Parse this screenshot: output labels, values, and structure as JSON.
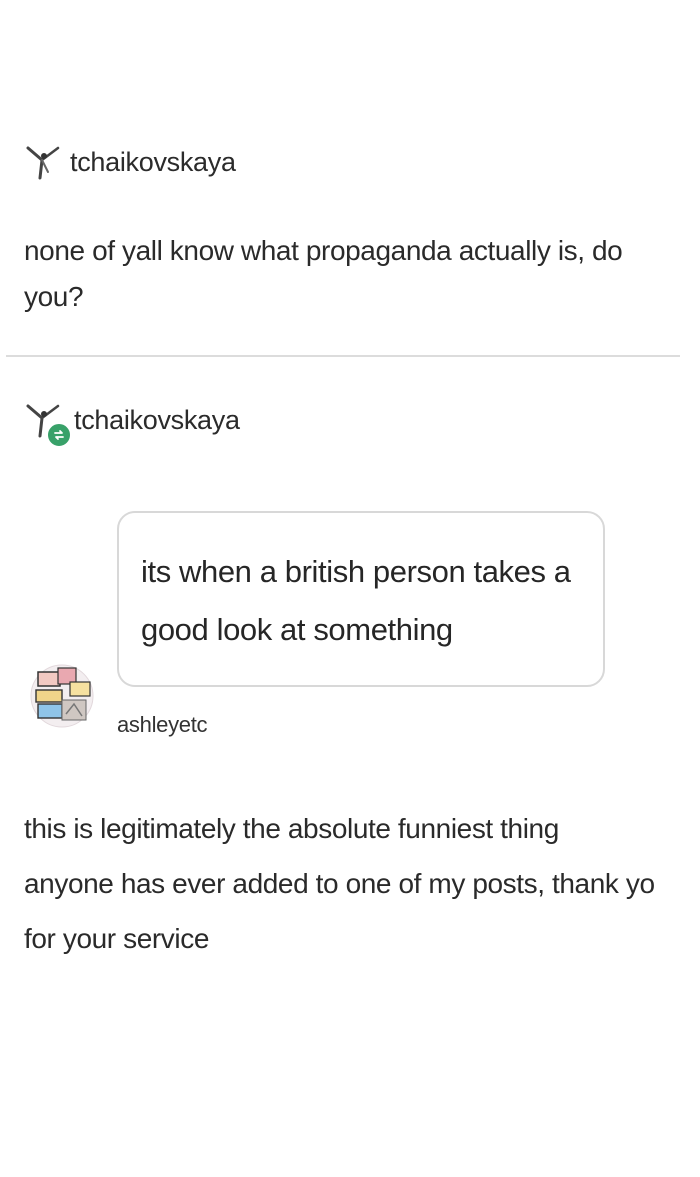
{
  "original_post": {
    "username": "tchaikovskaya",
    "text_line_1": "none of yall know what propaganda actually is, do",
    "text_line_2": "you?"
  },
  "reblog": {
    "username": "tchaikovskaya",
    "reply_bubble": {
      "line_1": "its when a british person takes a",
      "line_2": "good look at something"
    },
    "reply_author": "ashleyetc"
  },
  "comment": {
    "line_1": "this is legitimately the absolute funniest thing",
    "line_2": "anyone has ever added to one of my posts, thank yo",
    "line_3": "for your service"
  },
  "icons": {
    "avatar_1": "dancer-avatar-icon",
    "avatar_2": "dancer-avatar-icon",
    "reblog_badge": "reblog-icon",
    "reply_avatar": "collage-avatar-icon"
  },
  "colors": {
    "reblog_badge": "#38a169",
    "divider": "#dcdcdc",
    "bubble_border": "#d8d8d8"
  }
}
